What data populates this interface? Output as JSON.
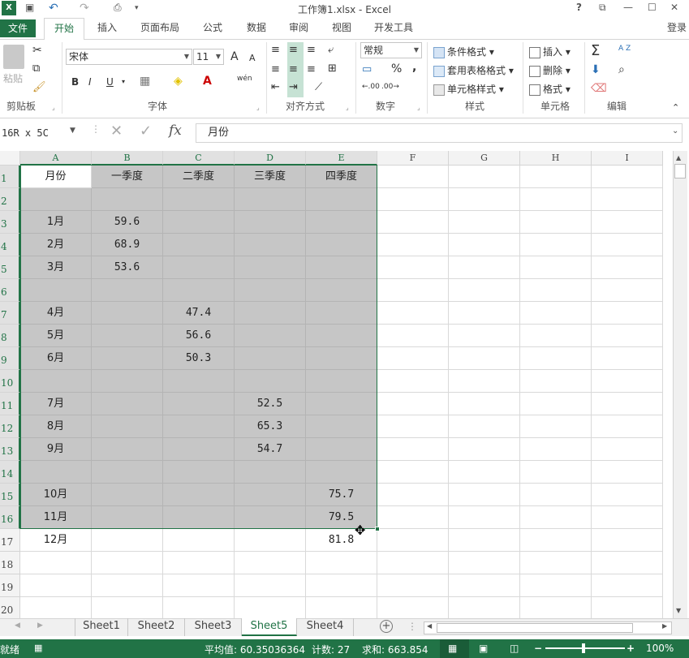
{
  "window": {
    "title": "工作簿1.xlsx - Excel",
    "controls": [
      "?",
      "⧉",
      "—",
      "☐",
      "✕"
    ],
    "login": "登录"
  },
  "qat": {
    "undo": "↶",
    "redo": "↷"
  },
  "tabs": [
    "文件",
    "开始",
    "插入",
    "页面布局",
    "公式",
    "数据",
    "审阅",
    "视图",
    "开发工具"
  ],
  "ribbon": {
    "clipboard": {
      "paste": "粘贴",
      "label": "剪贴板"
    },
    "font": {
      "name": "宋体",
      "size": "11",
      "label": "字体",
      "bold": "B",
      "italic": "I",
      "underline": "U",
      "grow": "A",
      "shrink": "A",
      "phonetic": "wén"
    },
    "alignment": {
      "label": "对齐方式"
    },
    "number": {
      "format": "常规",
      "label": "数字",
      "percent": "%",
      "comma": ","
    },
    "styles": {
      "conditional": "条件格式",
      "table": "套用表格格式",
      "cell": "单元格样式",
      "label": "样式"
    },
    "cells": {
      "insert": "插入",
      "delete": "删除",
      "format": "格式",
      "label": "单元格"
    },
    "editing": {
      "label": "编辑",
      "sum": "Σ",
      "sort": "A Z"
    }
  },
  "formula_bar": {
    "name_box": "16R x 5C",
    "fx": "fx",
    "value": "月份"
  },
  "columns": [
    "A",
    "B",
    "C",
    "D",
    "E",
    "F",
    "G",
    "H",
    "I"
  ],
  "rows": [
    [
      "月份",
      "一季度",
      "二季度",
      "三季度",
      "四季度"
    ],
    [
      "",
      "",
      "",
      "",
      ""
    ],
    [
      "1月",
      "59.6",
      "",
      "",
      ""
    ],
    [
      "2月",
      "68.9",
      "",
      "",
      ""
    ],
    [
      "3月",
      "53.6",
      "",
      "",
      ""
    ],
    [
      "",
      "",
      "",
      "",
      ""
    ],
    [
      "4月",
      "",
      "47.4",
      "",
      ""
    ],
    [
      "5月",
      "",
      "56.6",
      "",
      ""
    ],
    [
      "6月",
      "",
      "50.3",
      "",
      ""
    ],
    [
      "",
      "",
      "",
      "",
      ""
    ],
    [
      "7月",
      "",
      "",
      "52.5",
      ""
    ],
    [
      "8月",
      "",
      "",
      "65.3",
      ""
    ],
    [
      "9月",
      "",
      "",
      "54.7",
      ""
    ],
    [
      "",
      "",
      "",
      "",
      ""
    ],
    [
      "10月",
      "",
      "",
      "",
      "75.7"
    ],
    [
      "11月",
      "",
      "",
      "",
      "79.5"
    ],
    [
      "12月",
      "",
      "",
      "",
      "81.8"
    ],
    [
      "",
      "",
      "",
      "",
      ""
    ],
    [
      "",
      "",
      "",
      "",
      ""
    ],
    [
      "",
      "",
      "",
      "",
      ""
    ]
  ],
  "sheets": [
    "Sheet1",
    "Sheet2",
    "Sheet3",
    "Sheet5",
    "Sheet4"
  ],
  "active_sheet": "Sheet5",
  "status": {
    "ready": "就绪",
    "average": "平均值: 60.35036364",
    "count": "计数: 27",
    "sum": "求和: 663.854",
    "zoom": "100%"
  },
  "colors": {
    "accent": "#217346",
    "selection": "#c6c6c6"
  }
}
